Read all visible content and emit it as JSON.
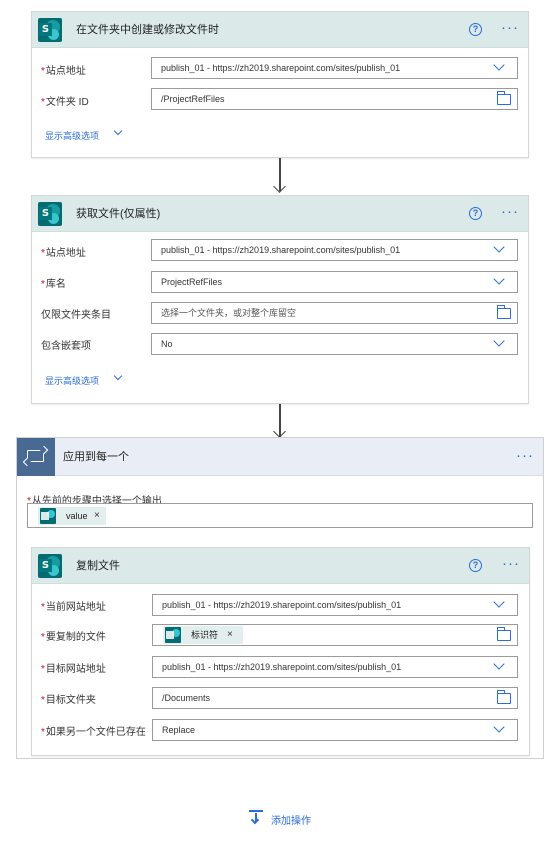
{
  "card1": {
    "title": "在文件夹中创建或修改文件时",
    "fields": [
      {
        "label": "站点地址",
        "required": "*",
        "value": "publish_01 - https://zh2019.sharepoint.com/sites/publish_01"
      },
      {
        "label": "文件夹 ID",
        "required": "*",
        "value": "/ProjectRefFiles"
      }
    ],
    "advanced": "显示高级选项"
  },
  "card2": {
    "title": "获取文件(仅属性)",
    "fields": [
      {
        "label": "站点地址",
        "required": "*",
        "value": "publish_01 - https://zh2019.sharepoint.com/sites/publish_01"
      },
      {
        "label": "库名",
        "required": "*",
        "value": "ProjectRefFiles"
      },
      {
        "label": "仅限文件夹条目",
        "required": "",
        "value": "选择一个文件夹，或对整个库留空"
      },
      {
        "label": "包含嵌套项",
        "required": "",
        "value": "No"
      }
    ],
    "advanced": "显示高级选项"
  },
  "loop": {
    "title": "应用到每一个",
    "output_label": "从先前的步骤中选择一个输出",
    "output_required": "*",
    "token": "value"
  },
  "card3": {
    "title": "复制文件",
    "fields": [
      {
        "label": "当前网站地址",
        "required": "*",
        "value": "publish_01 - https://zh2019.sharepoint.com/sites/publish_01"
      },
      {
        "label": "要复制的文件",
        "required": "*",
        "token": "标识符"
      },
      {
        "label": "目标网站地址",
        "required": "*",
        "value": "publish_01 - https://zh2019.sharepoint.com/sites/publish_01"
      },
      {
        "label": "目标文件夹",
        "required": "*",
        "value": "/Documents"
      },
      {
        "label": "如果另一个文件已存在",
        "required": "*",
        "value": "Replace"
      }
    ]
  },
  "add_action": "添加操作",
  "icons": {
    "help": "?",
    "more": "···",
    "close": "×"
  },
  "colors": {
    "accent": "#2b6cd6",
    "sharepoint": "#036c70",
    "required": "#c50f1f",
    "loop": "#486991"
  }
}
